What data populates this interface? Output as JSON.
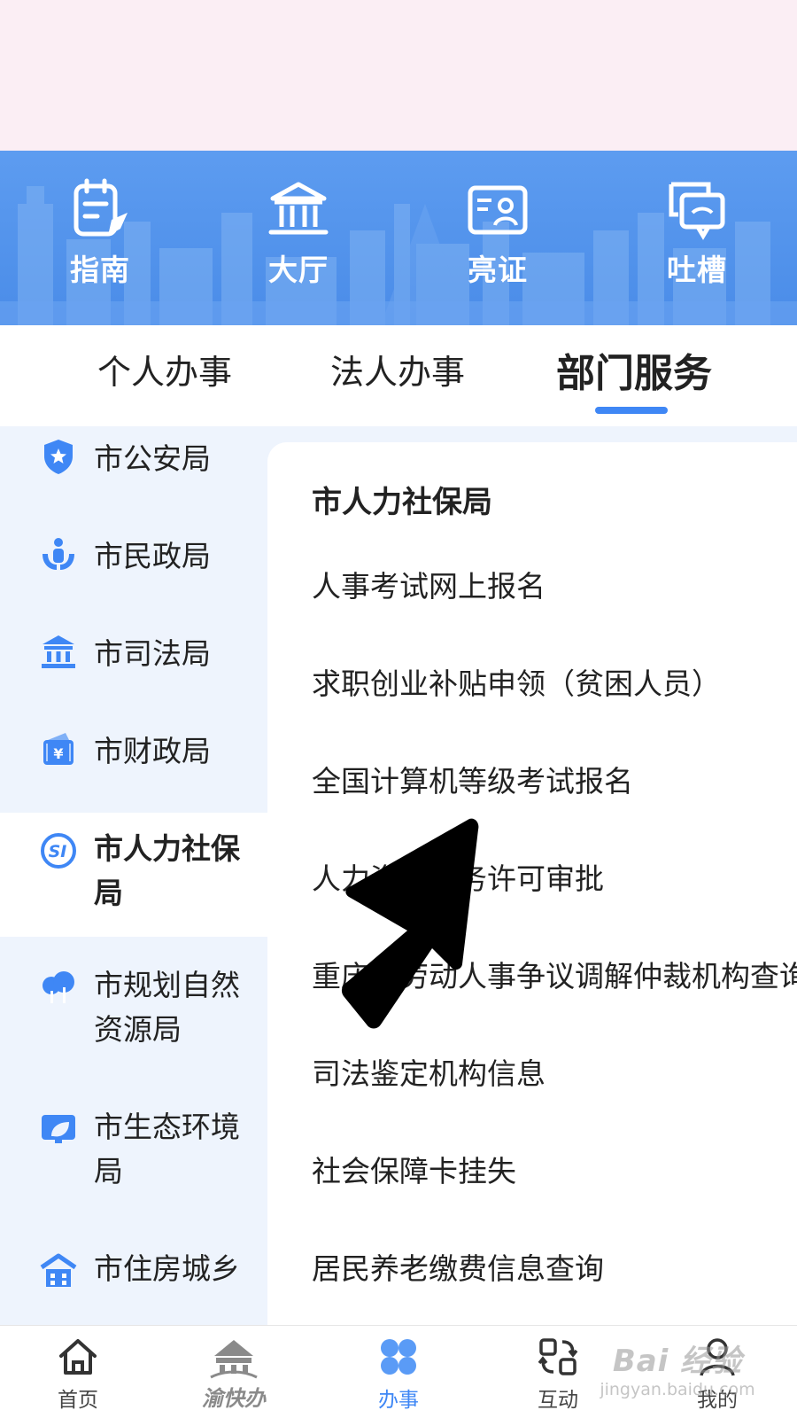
{
  "quick_actions": [
    {
      "label": "指南",
      "icon": "guide-icon"
    },
    {
      "label": "大厅",
      "icon": "hall-icon"
    },
    {
      "label": "亮证",
      "icon": "id-card-icon"
    },
    {
      "label": "吐槽",
      "icon": "feedback-icon"
    }
  ],
  "tabs": [
    {
      "label": "个人办事",
      "active": false
    },
    {
      "label": "法人办事",
      "active": false
    },
    {
      "label": "部门服务",
      "active": true
    }
  ],
  "sidebar": {
    "items": [
      {
        "label": "市公安局",
        "icon": "police-shield-icon"
      },
      {
        "label": "市民政局",
        "icon": "civil-affairs-hands-icon"
      },
      {
        "label": "市司法局",
        "icon": "justice-building-icon"
      },
      {
        "label": "市财政局",
        "icon": "finance-wallet-icon"
      },
      {
        "label": "市人力社保局",
        "icon": "social-insurance-icon",
        "active": true
      },
      {
        "label": "市规划自然资源局",
        "icon": "nature-trees-icon"
      },
      {
        "label": "市生态环境局",
        "icon": "ecology-leaf-icon"
      },
      {
        "label": "市住房城乡",
        "icon": "housing-icon"
      }
    ]
  },
  "panel": {
    "title": "市人力社保局",
    "services": [
      "人事考试网上报名",
      "求职创业补贴申领（贫困人员）",
      "全国计算机等级考试报名",
      "人力资源服务许可审批",
      "重庆市劳动人事争议调解仲裁机构查询",
      "司法鉴定机构信息",
      "社会保障卡挂失",
      "居民养老缴费信息查询"
    ]
  },
  "bottom_nav": {
    "items": [
      {
        "label": "首页",
        "icon": "home-icon",
        "active": false
      },
      {
        "label": "渝快办",
        "icon": "brand-logo-icon",
        "active": false
      },
      {
        "label": "办事",
        "icon": "services-clover-icon",
        "active": true
      },
      {
        "label": "互动",
        "icon": "interact-icon",
        "active": false
      },
      {
        "label": "我的",
        "icon": "profile-icon",
        "active": false
      }
    ]
  },
  "watermark": {
    "main": "Bai 经验",
    "sub": "jingyan.baidu.com"
  },
  "colors": {
    "accent": "#3f87f5",
    "banner": "#5d9cf0",
    "sidebar_bg": "#eef4fd",
    "top_bg": "#fbeef4"
  }
}
